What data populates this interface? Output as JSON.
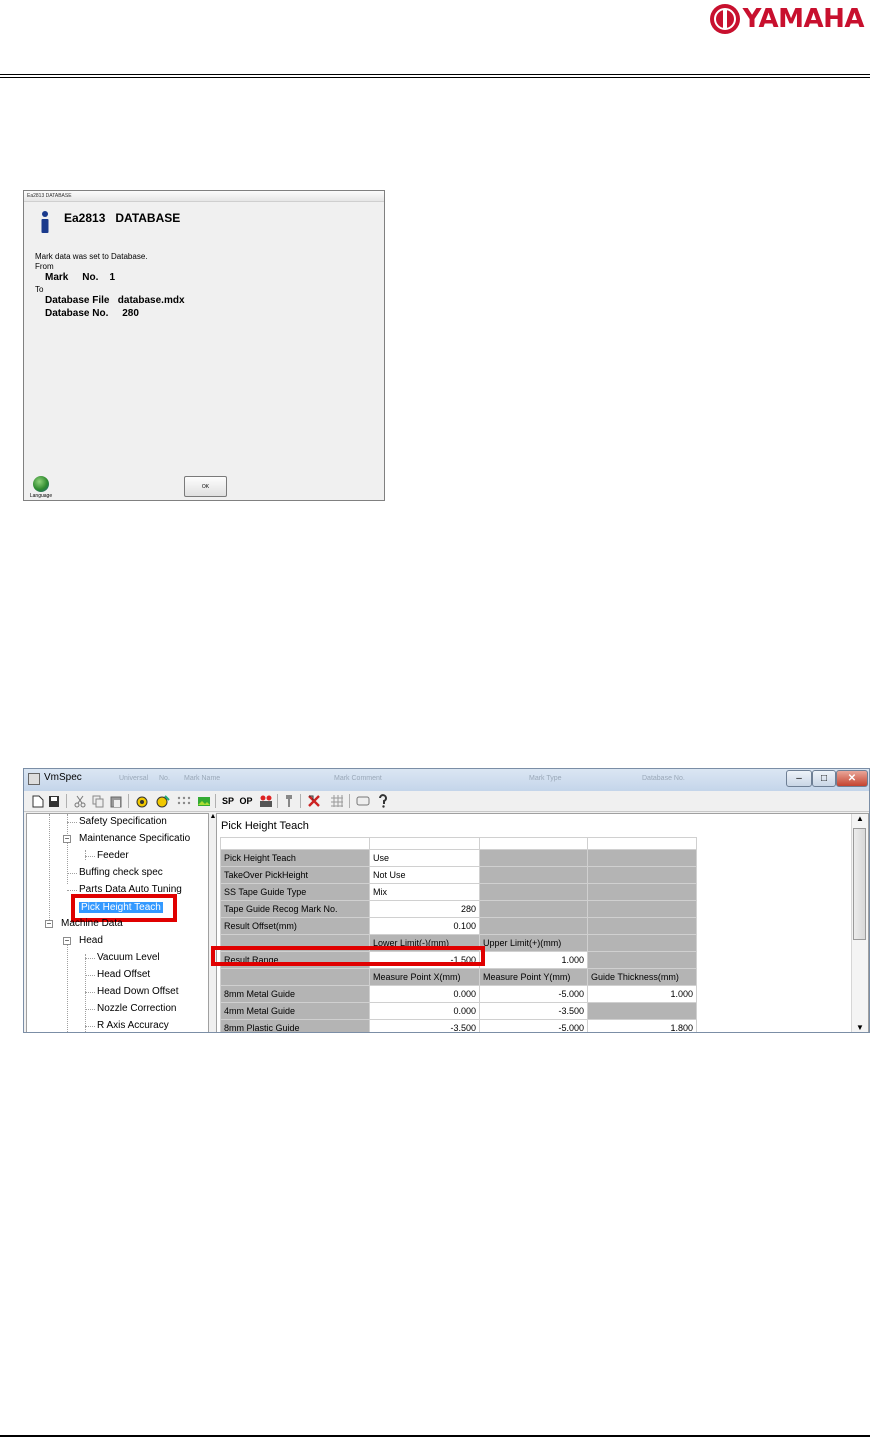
{
  "header": {
    "brand": "YAMAHA"
  },
  "dialog": {
    "window_title": "Ea2813 DATABASE",
    "heading": "Ea2813   DATABASE",
    "message": "Mark data was set to Database.",
    "from_label": "From",
    "from_value": "Mark     No.    1",
    "to_label": "To",
    "db_file": "Database File   database.mdx",
    "db_no": "Database No.     280",
    "language_label": "Language",
    "ok_label": "OK"
  },
  "vmspec": {
    "title": "VmSpec",
    "ghost_headers": [
      "Universal",
      "No.",
      "Mark Name",
      "Mark Comment",
      "Mark Type",
      "Database No."
    ],
    "window_buttons": {
      "minimize": "–",
      "maximize": "□",
      "close": "✕"
    },
    "toolbar": {
      "icons": [
        "new-file-icon",
        "save-icon",
        "cut-icon",
        "copy-icon",
        "paste-icon",
        "camera-icon",
        "camera-settings-icon",
        "dots-grid-icon",
        "image-icon",
        "sp-button",
        "op-button",
        "people-icon",
        "pin-icon",
        "cross-tools-icon",
        "grid-icon",
        "keyboard-icon",
        "help-icon"
      ],
      "sp_label": "SP",
      "op_label": "OP"
    },
    "tree": {
      "items": [
        {
          "label": "Safety Specification"
        },
        {
          "label": "Maintenance Specificatio"
        },
        {
          "label": "Feeder"
        },
        {
          "label": "Buffing check spec"
        },
        {
          "label": "Parts Data Auto Tuning"
        },
        {
          "label": "Pick Height Teach",
          "selected": true
        },
        {
          "label": "Machine Data"
        },
        {
          "label": "Head"
        },
        {
          "label": "Vacuum Level"
        },
        {
          "label": "Head Offset"
        },
        {
          "label": "Head Down Offset"
        },
        {
          "label": "Nozzle Correction"
        },
        {
          "label": "R Axis Accuracy"
        }
      ],
      "expand_symbol": "−",
      "scroll_up": "▲"
    },
    "pane": {
      "title": "Pick Height Teach",
      "rows": [
        [
          "",
          "",
          "",
          ""
        ],
        [
          "Pick Height Teach",
          "Use",
          "",
          ""
        ],
        [
          "TakeOver PickHeight",
          "Not Use",
          "",
          ""
        ],
        [
          "SS Tape Guide Type",
          "Mix",
          "",
          ""
        ],
        [
          "Tape Guide Recog Mark No.",
          "280",
          "",
          ""
        ],
        [
          "Result Offset(mm)",
          "0.100",
          "",
          ""
        ],
        [
          "",
          "Lower Limit(-)(mm)",
          "Upper Limit(+)(mm)",
          ""
        ],
        [
          "Result Range",
          "-1.500",
          "1.000",
          ""
        ],
        [
          "",
          "Measure Point X(mm)",
          "Measure Point Y(mm)",
          "Guide Thickness(mm)"
        ],
        [
          "8mm Metal Guide",
          "0.000",
          "-5.000",
          "1.000"
        ],
        [
          "4mm Metal Guide",
          "0.000",
          "-3.500",
          ""
        ],
        [
          "8mm Plastic Guide",
          "-3.500",
          "-5.000",
          "1.800"
        ]
      ],
      "scroll_up": "▲",
      "scroll_down": "▼"
    }
  }
}
